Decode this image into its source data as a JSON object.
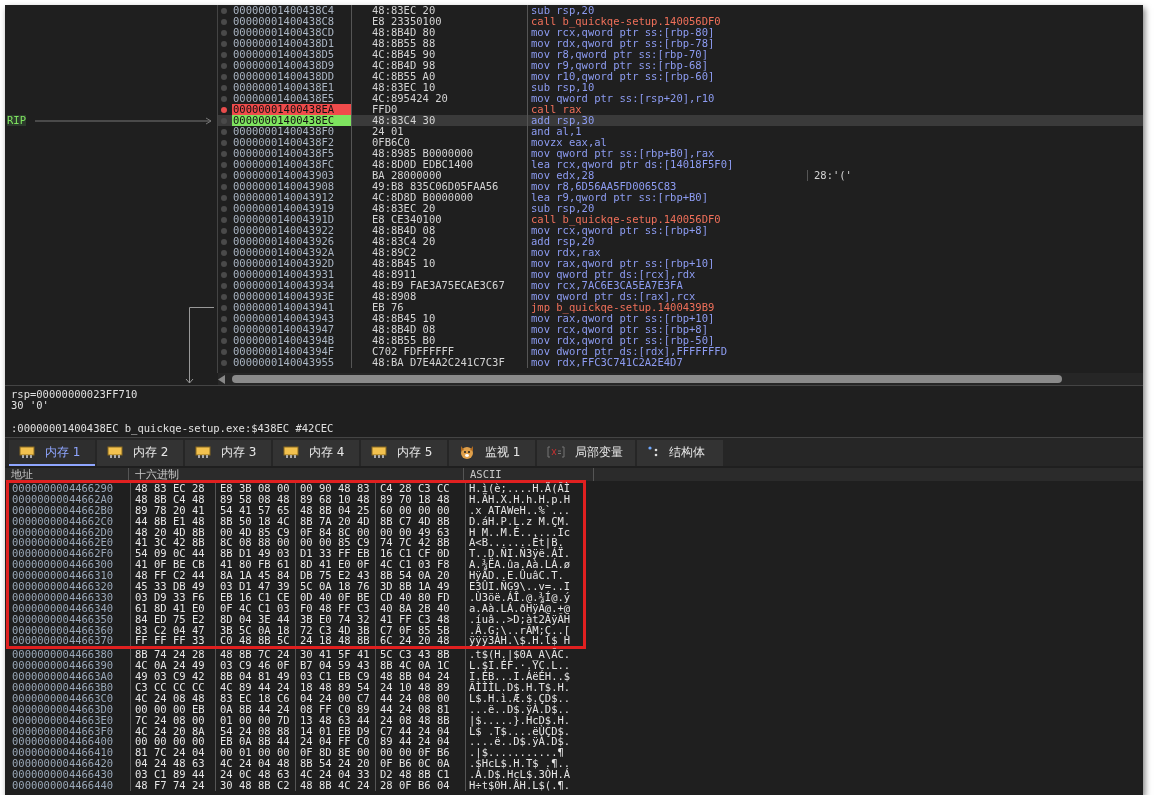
{
  "disassembly": {
    "rip_label": "RIP",
    "rows": [
      {
        "address": "00000001400438C4",
        "bytes": "48:83EC 20",
        "instruction": "sub rsp,20",
        "kind": "op",
        "breakpoint": false,
        "current": false
      },
      {
        "address": "00000001400438C8",
        "bytes": "E8 23350100",
        "instruction": "call b_quickqe-setup.140056DF0",
        "kind": "call",
        "breakpoint": false,
        "current": false
      },
      {
        "address": "00000001400438CD",
        "bytes": "48:8B4D 80",
        "instruction": "mov rcx,qword ptr ss:[rbp-80]",
        "kind": "op",
        "breakpoint": false,
        "current": false
      },
      {
        "address": "00000001400438D1",
        "bytes": "48:8B55 88",
        "instruction": "mov rdx,qword ptr ss:[rbp-78]",
        "kind": "op",
        "breakpoint": false,
        "current": false
      },
      {
        "address": "00000001400438D5",
        "bytes": "4C:8B45 90",
        "instruction": "mov r8,qword ptr ss:[rbp-70]",
        "kind": "op",
        "breakpoint": false,
        "current": false
      },
      {
        "address": "00000001400438D9",
        "bytes": "4C:8B4D 98",
        "instruction": "mov r9,qword ptr ss:[rbp-68]",
        "kind": "op",
        "breakpoint": false,
        "current": false
      },
      {
        "address": "00000001400438DD",
        "bytes": "4C:8B55 A0",
        "instruction": "mov r10,qword ptr ss:[rbp-60]",
        "kind": "op",
        "breakpoint": false,
        "current": false
      },
      {
        "address": "00000001400438E1",
        "bytes": "48:83EC 10",
        "instruction": "sub rsp,10",
        "kind": "op",
        "breakpoint": false,
        "current": false
      },
      {
        "address": "00000001400438E5",
        "bytes": "4C:895424 20",
        "instruction": "mov qword ptr ss:[rsp+20],r10",
        "kind": "op",
        "breakpoint": false,
        "current": false
      },
      {
        "address": "00000001400438EA",
        "bytes": "FFD0",
        "instruction": "call rax",
        "kind": "call",
        "breakpoint": true,
        "current": false
      },
      {
        "address": "00000001400438EC",
        "bytes": "48:83C4 30",
        "instruction": "add rsp,30",
        "kind": "op",
        "breakpoint": false,
        "current": true
      },
      {
        "address": "00000001400438F0",
        "bytes": "24 01",
        "instruction": "and al,1",
        "kind": "op",
        "breakpoint": false,
        "current": false
      },
      {
        "address": "00000001400438F2",
        "bytes": "0FB6C0",
        "instruction": "movzx eax,al",
        "kind": "op",
        "breakpoint": false,
        "current": false
      },
      {
        "address": "00000001400438F5",
        "bytes": "48:8985 B0000000",
        "instruction": "mov qword ptr ss:[rbp+B0],rax",
        "kind": "op",
        "breakpoint": false,
        "current": false
      },
      {
        "address": "00000001400438FC",
        "bytes": "48:8D0D EDBC1400",
        "instruction": "lea rcx,qword ptr ds:[14018F5F0]",
        "kind": "op",
        "breakpoint": false,
        "current": false
      },
      {
        "address": "0000000140043903",
        "bytes": "BA 28000000",
        "instruction": "mov edx,28",
        "kind": "op",
        "breakpoint": false,
        "current": false,
        "comment": "28:'('"
      },
      {
        "address": "0000000140043908",
        "bytes": "49:B8 835C06D05FAA56",
        "instruction": "mov r8,6D56AA5FD0065C83",
        "kind": "op",
        "breakpoint": false,
        "current": false
      },
      {
        "address": "0000000140043912",
        "bytes": "4C:8D8D B0000000",
        "instruction": "lea r9,qword ptr ss:[rbp+B0]",
        "kind": "op",
        "breakpoint": false,
        "current": false
      },
      {
        "address": "0000000140043919",
        "bytes": "48:83EC 20",
        "instruction": "sub rsp,20",
        "kind": "op",
        "breakpoint": false,
        "current": false
      },
      {
        "address": "000000014004391D",
        "bytes": "E8 CE340100",
        "instruction": "call b_quickqe-setup.140056DF0",
        "kind": "call",
        "breakpoint": false,
        "current": false
      },
      {
        "address": "0000000140043922",
        "bytes": "48:8B4D 08",
        "instruction": "mov rcx,qword ptr ss:[rbp+8]",
        "kind": "op",
        "breakpoint": false,
        "current": false
      },
      {
        "address": "0000000140043926",
        "bytes": "48:83C4 20",
        "instruction": "add rsp,20",
        "kind": "op",
        "breakpoint": false,
        "current": false
      },
      {
        "address": "000000014004392A",
        "bytes": "48:89C2",
        "instruction": "mov rdx,rax",
        "kind": "op",
        "breakpoint": false,
        "current": false
      },
      {
        "address": "000000014004392D",
        "bytes": "48:8B45 10",
        "instruction": "mov rax,qword ptr ss:[rbp+10]",
        "kind": "op",
        "breakpoint": false,
        "current": false
      },
      {
        "address": "0000000140043931",
        "bytes": "48:8911",
        "instruction": "mov qword ptr ds:[rcx],rdx",
        "kind": "op",
        "breakpoint": false,
        "current": false
      },
      {
        "address": "0000000140043934",
        "bytes": "48:B9 FAE3A75ECAE3C67",
        "instruction": "mov rcx,7AC6E3CA5EA7E3FA",
        "kind": "op",
        "breakpoint": false,
        "current": false
      },
      {
        "address": "000000014004393E",
        "bytes": "48:8908",
        "instruction": "mov qword ptr ds:[rax],rcx",
        "kind": "op",
        "breakpoint": false,
        "current": false
      },
      {
        "address": "0000000140043941",
        "bytes": "EB 76",
        "instruction": "jmp b_quickqe-setup.1400439B9",
        "kind": "jmp",
        "breakpoint": false,
        "current": false
      },
      {
        "address": "0000000140043943",
        "bytes": "48:8B45 10",
        "instruction": "mov rax,qword ptr ss:[rbp+10]",
        "kind": "op",
        "breakpoint": false,
        "current": false
      },
      {
        "address": "0000000140043947",
        "bytes": "48:8B4D 08",
        "instruction": "mov rcx,qword ptr ss:[rbp+8]",
        "kind": "op",
        "breakpoint": false,
        "current": false
      },
      {
        "address": "000000014004394B",
        "bytes": "48:8B55 B0",
        "instruction": "mov rdx,qword ptr ss:[rbp-50]",
        "kind": "op",
        "breakpoint": false,
        "current": false
      },
      {
        "address": "000000014004394F",
        "bytes": "C702 FDFFFFFF",
        "instruction": "mov dword ptr ds:[rdx],FFFFFFFD",
        "kind": "op",
        "breakpoint": false,
        "current": false
      },
      {
        "address": "0000000140043955",
        "bytes": "48:BA D7E4A2C241C7C3F",
        "instruction": "mov rdx,FFC3C741C2A2E4D7",
        "kind": "op",
        "breakpoint": false,
        "current": false
      }
    ]
  },
  "info": {
    "lines": [
      "rsp=00000000023FF710",
      "30 '0'"
    ],
    "location": ":00000001400438EC b_quickqe-setup.exe:$438EC #42CEC"
  },
  "tabs": [
    {
      "label": "内存 1",
      "kind": "memory",
      "selected": true
    },
    {
      "label": "内存 2",
      "kind": "memory",
      "selected": false
    },
    {
      "label": "内存 3",
      "kind": "memory",
      "selected": false
    },
    {
      "label": "内存 4",
      "kind": "memory",
      "selected": false
    },
    {
      "label": "内存 5",
      "kind": "memory",
      "selected": false
    },
    {
      "label": "监视 1",
      "kind": "watch",
      "selected": false
    },
    {
      "label": "局部变量",
      "kind": "locals",
      "selected": false
    },
    {
      "label": "结构体",
      "kind": "struct",
      "selected": false
    }
  ],
  "memory": {
    "columns": [
      "地址",
      "十六进制",
      "ASCII"
    ],
    "highlighted_rows": [
      {
        "address": "0000000004466290",
        "hex": [
          "48 83 EC 28",
          "E8 3B 08 00",
          "00 90 48 83",
          "C4 28 C3 CC"
        ],
        "ascii": "H.ì(è;....H.Ä(ÃÌ"
      },
      {
        "address": "00000000044662A0",
        "hex": [
          "48 8B C4 48",
          "89 58 08 48",
          "89 68 10 48",
          "89 70 18 48"
        ],
        "ascii": "H.ÄH.X.H.h.H.p.H"
      },
      {
        "address": "00000000044662B0",
        "hex": [
          "89 78 20 41",
          "54 41 57 65",
          "48 8B 04 25",
          "60 00 00 00"
        ],
        "ascii": ".x ATAWeH..%`..."
      },
      {
        "address": "00000000044662C0",
        "hex": [
          "44 8B E1 48",
          "8B 50 18 4C",
          "8B 7A 20 4D",
          "8B C7 4D 8B"
        ],
        "ascii": "D.áH.P.L.z M.ÇM."
      },
      {
        "address": "00000000044662D0",
        "hex": [
          "48 20 4D 8B",
          "00 4D 85 C9",
          "0F 84 8C 00",
          "00 00 49 63"
        ],
        "ascii": "H M..M.É......Ic"
      },
      {
        "address": "00000000044662E0",
        "hex": [
          "41 3C 42 8B",
          "8C 08 88 00",
          "00 00 85 C9",
          "74 7C 42 8B"
        ],
        "ascii": "A<B.......Ét|B."
      },
      {
        "address": "00000000044662F0",
        "hex": [
          "54 09 0C 44",
          "8B D1 49 03",
          "D1 33 FF EB",
          "16 C1 CF 0D"
        ],
        "ascii": "T..D.ÑI.Ñ3ÿë.ÁÏ."
      },
      {
        "address": "0000000004466300",
        "hex": [
          "41 0F BE CB",
          "41 80 FB 61",
          "8D 41 E0 0F",
          "4C C1 03 F8"
        ],
        "ascii": "A.¾ËA.ûa.Aà.LÁ.ø"
      },
      {
        "address": "0000000004466310",
        "hex": [
          "48 FF C2 44",
          "8A 1A 45 84",
          "DB 75 E2 43",
          "8B 54 0A 20"
        ],
        "ascii": "HÿÂD..E.ÛuâC.T. "
      },
      {
        "address": "0000000004466320",
        "hex": [
          "45 33 DB 49",
          "03 D1 47 39",
          "5C 0A 18 76",
          "3D 8B 1A 49"
        ],
        "ascii": "E3ÛI.ÑG9\\..v=..I"
      },
      {
        "address": "0000000004466330",
        "hex": [
          "03 D9 33 F6",
          "EB 16 C1 CE",
          "0D 40 0F BE",
          "CD 40 80 FD"
        ],
        "ascii": ".Ù3öë.ÁÎ.@.¾Í@.ý"
      },
      {
        "address": "0000000004466340",
        "hex": [
          "61 8D 41 E0",
          "0F 4C C1 03",
          "F0 48 FF C3",
          "40 8A 2B 40"
        ],
        "ascii": "a.Aà.LÁ.ðHÿÃ@.+@"
      },
      {
        "address": "0000000004466350",
        "hex": [
          "84 ED 75 E2",
          "8D 04 3E 44",
          "3B E0 74 32",
          "41 FF C3 48"
        ],
        "ascii": ".íuâ..>D;àt2AÿÃH"
      },
      {
        "address": "0000000004466360",
        "hex": [
          "83 C2 04 47",
          "3B 5C 0A 18",
          "72 C3 4D 3B",
          "C7 0F 85 5B"
        ],
        "ascii": ".Â.G;\\..rÃM;Ç..["
      },
      {
        "address": "0000000004466370",
        "hex": [
          "FF FF FF 33",
          "C0 48 8B 5C",
          "24 18 48 8B",
          "6C 24 20 48"
        ],
        "ascii": "ÿÿÿ3ÀH.\\$.H.l$ H"
      }
    ],
    "rows": [
      {
        "address": "0000000004466380",
        "hex": [
          "8B 74 24 28",
          "48 8B 7C 24",
          "30 41 5F 41",
          "5C C3 43 8B"
        ],
        "ascii": ".t$(H.|$0A_A\\ÃC."
      },
      {
        "address": "0000000004466390",
        "hex": [
          "4C 0A 24 49",
          "03 C9 46 0F",
          "B7 04 59 43",
          "8B 4C 0A 1C"
        ],
        "ascii": "L.$I.ÉF.·.YC.L.."
      },
      {
        "address": "00000000044663A0",
        "hex": [
          "49 03 C9 42",
          "8B 04 81 49",
          "03 C1 EB C9",
          "48 8B 04 24"
        ],
        "ascii": "I.ÉB...I.ÁëÉH..$"
      },
      {
        "address": "00000000044663B0",
        "hex": [
          "C3 CC CC CC",
          "4C 89 44 24",
          "18 48 89 54",
          "24 10 48 89"
        ],
        "ascii": "ÃÌÌÌL.D$.H.T$.H."
      },
      {
        "address": "00000000044663C0",
        "hex": [
          "4C 24 08 48",
          "83 EC 18 C6",
          "04 24 00 C7",
          "44 24 08 00"
        ],
        "ascii": "L$.H.ì.Æ.$.ÇD$.."
      },
      {
        "address": "00000000044663D0",
        "hex": [
          "00 00 00 EB",
          "0A 8B 44 24",
          "08 FF C0 89",
          "44 24 08 81"
        ],
        "ascii": "...ë..D$.ÿÀ.D$.."
      },
      {
        "address": "00000000044663E0",
        "hex": [
          "7C 24 08 00",
          "01 00 00 7D",
          "13 48 63 44",
          "24 08 48 8B"
        ],
        "ascii": "|$.....}.HcD$.H."
      },
      {
        "address": "00000000044663F0",
        "hex": [
          "4C 24 20 8A",
          "54 24 08 88",
          "14 01 EB D9",
          "C7 44 24 04"
        ],
        "ascii": "L$ .T$....ëÙÇD$."
      },
      {
        "address": "0000000004466400",
        "hex": [
          "00 00 00 00",
          "EB 0A 8B 44",
          "24 04 FF C0",
          "89 44 24 04"
        ],
        "ascii": "....ë..D$.ÿÀ.D$."
      },
      {
        "address": "0000000004466410",
        "hex": [
          "81 7C 24 04",
          "00 01 00 00",
          "0F 8D 8E 00",
          "00 00 0F B6"
        ],
        "ascii": ".|$...........¶"
      },
      {
        "address": "0000000004466420",
        "hex": [
          "04 24 48 63",
          "4C 24 04 48",
          "8B 54 24 20",
          "0F B6 0C 0A"
        ],
        "ascii": ".$HcL$.H.T$ .¶.."
      },
      {
        "address": "0000000004466430",
        "hex": [
          "03 C1 89 44",
          "24 0C 48 63",
          "4C 24 04 33",
          "D2 48 8B C1"
        ],
        "ascii": ".Á.D$.HcL$.3ÒH.Á"
      },
      {
        "address": "0000000004466440",
        "hex": [
          "48 F7 74 24",
          "30 48 8B C2",
          "48 8B 4C 24",
          "28 0F B6 04"
        ],
        "ascii": "H÷t$0H.ÂH.L$(.¶."
      }
    ]
  }
}
